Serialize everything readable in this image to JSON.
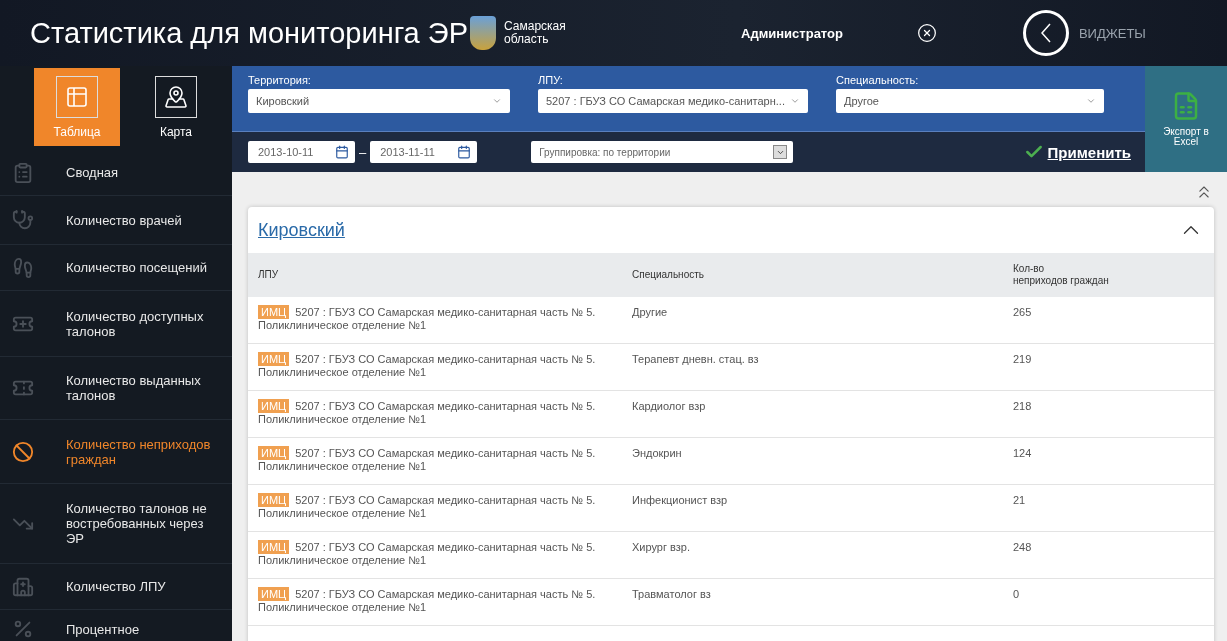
{
  "header": {
    "title": "Статистика для мониторинга ЭР",
    "region": "Самарская область",
    "user": "Администратор",
    "widgets": "ВИДЖЕТЫ"
  },
  "view_tabs": [
    {
      "label": "Таблица",
      "kind": "table",
      "selected": true
    },
    {
      "label": "Карта",
      "kind": "map",
      "selected": false
    }
  ],
  "sidebar": {
    "items": [
      {
        "label": "Сводная",
        "kind": "summary",
        "selected": false
      },
      {
        "label": "Количество врачей",
        "kind": "doctors",
        "selected": false
      },
      {
        "label": "Количество посещений",
        "kind": "visits",
        "selected": false
      },
      {
        "label": "Количество доступных талонов",
        "kind": "ticket-plus",
        "selected": false
      },
      {
        "label": "Количество выданных талонов",
        "kind": "ticket",
        "selected": false
      },
      {
        "label": "Количество неприходов граждан",
        "kind": "noshow",
        "selected": true
      },
      {
        "label": "Количество талонов не востребованных через ЭР",
        "kind": "trend",
        "selected": false
      },
      {
        "label": "Количество ЛПУ",
        "kind": "hospital",
        "selected": false
      },
      {
        "label": "Процентное",
        "kind": "percent",
        "selected": false
      }
    ]
  },
  "filters": {
    "territory": {
      "label": "Территория:",
      "value": "Кировский"
    },
    "lpu": {
      "label": "ЛПУ:",
      "value": "5207 : ГБУЗ СО Самарская медико-санитарн..."
    },
    "specialty": {
      "label": "Специальность:",
      "value": "Другое"
    },
    "date_from": "2013-10-11",
    "date_to": "2013-11-11",
    "date_separator": "–",
    "grouping": "Группировка: по территории",
    "apply": "Применить",
    "export": "Экспорт в Excel"
  },
  "panel": {
    "title": "Кировский",
    "expanded": true,
    "columns": [
      "ЛПУ",
      "Специальность",
      "Кол-во\nнеприходов граждан"
    ],
    "rows": [
      {
        "tag": "ИМЦ",
        "lpu": "5207 : ГБУЗ СО Самарская медико-санитарная часть № 5. Поликлиническое отделение №1",
        "specialty": "Другие",
        "count": "265"
      },
      {
        "tag": "ИМЦ",
        "lpu": "5207 : ГБУЗ СО Самарская медико-санитарная часть № 5. Поликлиническое отделение №1",
        "specialty": "Терапевт дневн. стац. вз",
        "count": "219"
      },
      {
        "tag": "ИМЦ",
        "lpu": "5207 : ГБУЗ СО Самарская медико-санитарная часть № 5. Поликлиническое отделение №1",
        "specialty": "Кардиолог взр",
        "count": "218"
      },
      {
        "tag": "ИМЦ",
        "lpu": "5207 : ГБУЗ СО Самарская медико-санитарная часть № 5. Поликлиническое отделение №1",
        "specialty": "Эндокрин",
        "count": "124"
      },
      {
        "tag": "ИМЦ",
        "lpu": "5207 : ГБУЗ СО Самарская медико-санитарная часть № 5. Поликлиническое отделение №1",
        "specialty": "Инфекционист взр",
        "count": "21"
      },
      {
        "tag": "ИМЦ",
        "lpu": "5207 : ГБУЗ СО Самарская медико-санитарная часть № 5. Поликлиническое отделение №1",
        "specialty": "Хирург взр.",
        "count": "248"
      },
      {
        "tag": "ИМЦ",
        "lpu": "5207 : ГБУЗ СО Самарская медико-санитарная часть № 5. Поликлиническое отделение №1",
        "specialty": "Травматолог вз",
        "count": "0"
      }
    ]
  }
}
